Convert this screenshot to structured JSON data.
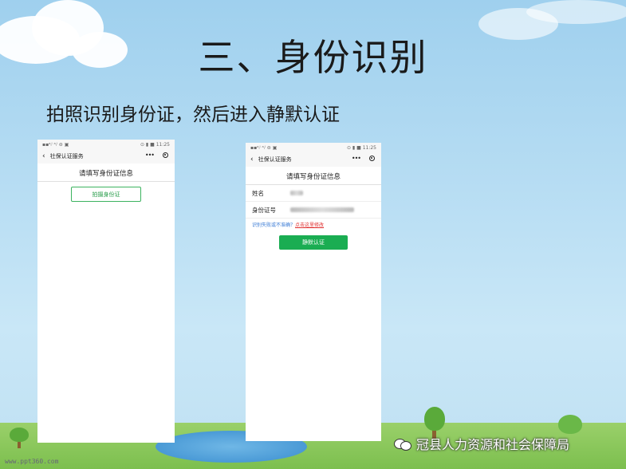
{
  "slide": {
    "title": "三、身份识别",
    "subtitle": "拍照识别身份证，然后进入静默认证",
    "footer_url": "www.ppt360.com",
    "watermark": "冠县人力资源和社会保障局"
  },
  "phone_left": {
    "status_left": "▪▪ᵃᵢˡ ᵃᵢˡ ⊜ ▣",
    "status_right": "⊙ ▮ ■ 11:25",
    "nav_back": "‹",
    "nav_title": "社保认证服务",
    "nav_more": "•••",
    "header": "请填写身份证信息",
    "photo_button": "拍摄身份证"
  },
  "phone_right": {
    "status_left": "▪▪ᵃᵢˡ ᵃᵢˡ ⊜ ▣",
    "status_right": "⊙ ▮ ■ 11:25",
    "nav_back": "‹",
    "nav_title": "社保认证服务",
    "nav_more": "•••",
    "header": "请填写身份证信息",
    "name_label": "姓名",
    "id_label": "身份证号",
    "hint_text": "识别失败或不准确？",
    "hint_link": "点击这里修改",
    "silent_button": "静默认证"
  },
  "colors": {
    "accent_green": "#1aad52",
    "link_red": "#e03030",
    "hint_blue": "#3a7bd5"
  },
  "icons": [
    "back-arrow-icon",
    "more-icon",
    "target-icon",
    "wechat-icon"
  ]
}
